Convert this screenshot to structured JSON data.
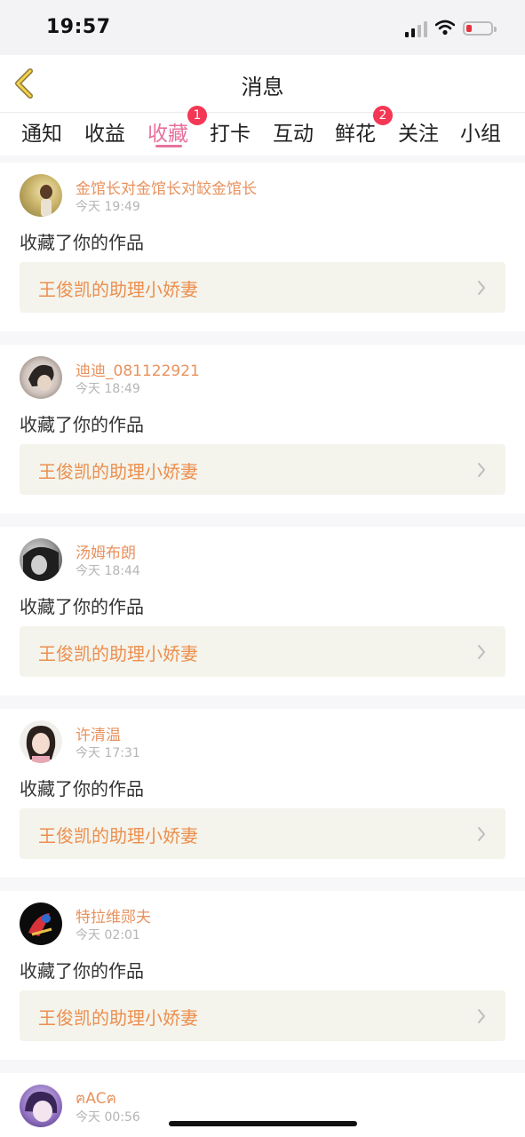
{
  "status_bar": {
    "time": "19:57",
    "battery_color": "#e8323c"
  },
  "header": {
    "title": "消息",
    "back_icon": "chevron-left-icon"
  },
  "tabs": [
    {
      "label": "通知"
    },
    {
      "label": "收益"
    },
    {
      "label": "收藏",
      "active": true,
      "badge": "1"
    },
    {
      "label": "打卡"
    },
    {
      "label": "互动"
    },
    {
      "label": "鲜花",
      "badge": "2"
    },
    {
      "label": "关注"
    },
    {
      "label": "小组"
    }
  ],
  "colors": {
    "accent": "#e7719d",
    "username": "#e8925e",
    "work_title": "#ec8f4f",
    "badge": "#f43754"
  },
  "notifications": [
    {
      "username": "金馆长对金馆长对䍊金馆长",
      "time": "今天 19:49",
      "action": "收藏了你的作品",
      "work": "王俊凯的助理小娇妻"
    },
    {
      "username": "迪迪_081122921",
      "time": "今天 18:49",
      "action": "收藏了你的作品",
      "work": "王俊凯的助理小娇妻"
    },
    {
      "username": "汤姆布朗",
      "time": "今天 18:44",
      "action": "收藏了你的作品",
      "work": "王俊凯的助理小娇妻"
    },
    {
      "username": "许清温",
      "time": "今天 17:31",
      "action": "收藏了你的作品",
      "work": "王俊凯的助理小娇妻"
    },
    {
      "username": "特拉维郧夫",
      "time": "今天 02:01",
      "action": "收藏了你的作品",
      "work": "王俊凯的助理小娇妻"
    },
    {
      "username": "ฅACฅ",
      "time": "今天 00:56"
    }
  ]
}
